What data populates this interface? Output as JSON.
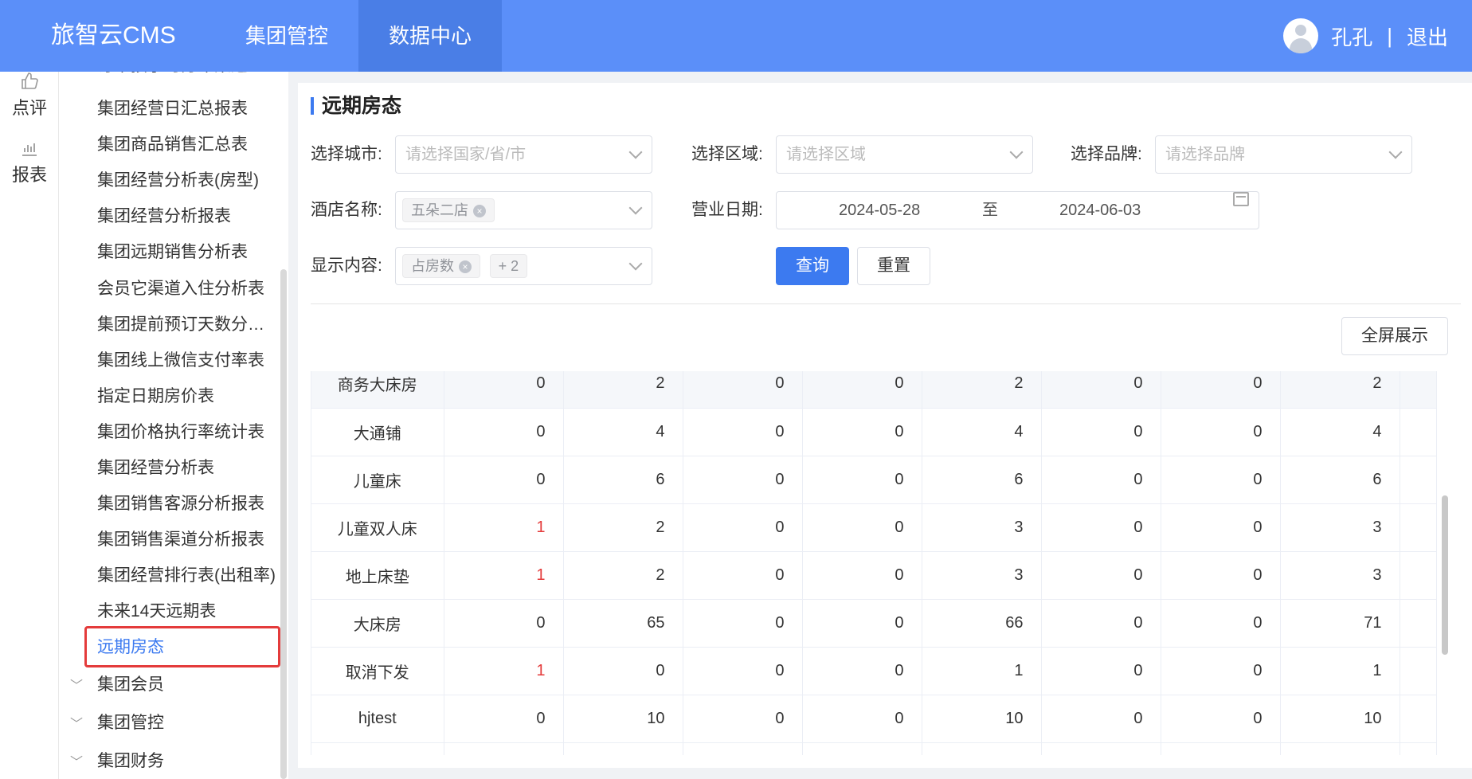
{
  "header": {
    "brand": "旅智云CMS",
    "nav": [
      {
        "label": "集团管控",
        "active": false
      },
      {
        "label": "数据中心",
        "active": true
      }
    ],
    "user_name": "孔孔",
    "separator": "|",
    "logout": "退出"
  },
  "rail": [
    {
      "label": "点评",
      "icon": "thumbs-up-icon"
    },
    {
      "label": "报表",
      "icon": "bar-chart-icon"
    }
  ],
  "submenu": {
    "items": [
      "订单按小时分布渠道…",
      "集团经营日汇总报表",
      "集团商品销售汇总表",
      "集团经营分析表(房型)",
      "集团经营分析报表",
      "集团远期销售分析表",
      "会员它渠道入住分析表",
      "集团提前预订天数分…",
      "集团线上微信支付率表",
      "指定日期房价表",
      "集团价格执行率统计表",
      "集团经营分析表",
      "集团销售客源分析报表",
      "集团销售渠道分析报表",
      "集团经营排行表(出租率)",
      "未来14天远期表",
      "远期房态"
    ],
    "active_index": 16,
    "groups": [
      "集团会员",
      "集团管控",
      "集团财务"
    ]
  },
  "page": {
    "title": "远期房态",
    "filters": {
      "city_label": "选择城市:",
      "city_placeholder": "请选择国家/省/市",
      "area_label": "选择区域:",
      "area_placeholder": "请选择区域",
      "brand_label": "选择品牌:",
      "brand_placeholder": "请选择品牌",
      "hotel_label": "酒店名称:",
      "hotel_tag": "五朵二店",
      "date_label": "营业日期:",
      "date_start": "2024-05-28",
      "date_sep": "至",
      "date_end": "2024-06-03",
      "content_label": "显示内容:",
      "content_tag": "占房数",
      "content_more": "+ 2"
    },
    "buttons": {
      "query": "查询",
      "reset": "重置",
      "fullscreen": "全屏展示"
    }
  },
  "table": {
    "rows": [
      {
        "name": "商务大床房",
        "values": [
          "0",
          "2",
          "0",
          "0",
          "2",
          "0",
          "0",
          "2"
        ],
        "red": []
      },
      {
        "name": "大通铺",
        "values": [
          "0",
          "4",
          "0",
          "0",
          "4",
          "0",
          "0",
          "4"
        ],
        "red": []
      },
      {
        "name": "儿童床",
        "values": [
          "0",
          "6",
          "0",
          "0",
          "6",
          "0",
          "0",
          "6"
        ],
        "red": []
      },
      {
        "name": "儿童双人床",
        "values": [
          "1",
          "2",
          "0",
          "0",
          "3",
          "0",
          "0",
          "3"
        ],
        "red": [
          0
        ]
      },
      {
        "name": "地上床垫",
        "values": [
          "1",
          "2",
          "0",
          "0",
          "3",
          "0",
          "0",
          "3"
        ],
        "red": [
          0
        ]
      },
      {
        "name": "大床房",
        "values": [
          "0",
          "65",
          "0",
          "0",
          "66",
          "0",
          "0",
          "71"
        ],
        "red": []
      },
      {
        "name": "取消下发",
        "values": [
          "1",
          "0",
          "0",
          "0",
          "1",
          "0",
          "0",
          "1"
        ],
        "red": [
          0
        ]
      },
      {
        "name": "hjtest",
        "values": [
          "0",
          "10",
          "0",
          "0",
          "10",
          "0",
          "0",
          "10"
        ],
        "red": []
      },
      {
        "name": "",
        "values": [
          "",
          "",
          "",
          "",
          "",
          "",
          "",
          ""
        ],
        "red": []
      }
    ]
  }
}
